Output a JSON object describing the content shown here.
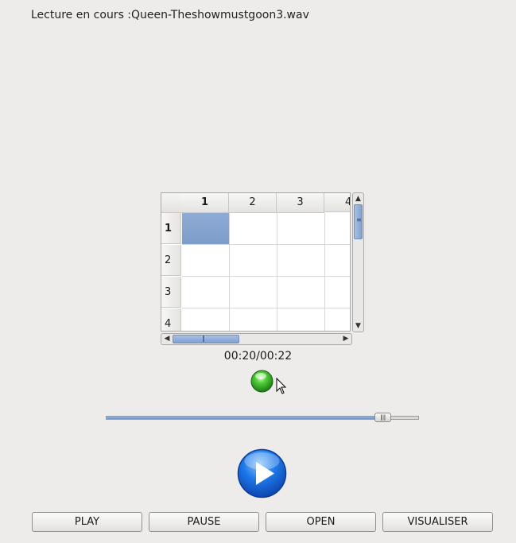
{
  "now_playing": {
    "label": "Lecture en cours :",
    "filename": "Queen-Theshowmustgoon3.wav"
  },
  "table": {
    "columns": [
      "1",
      "2",
      "3",
      "4"
    ],
    "rows": [
      "1",
      "2",
      "3",
      "4"
    ],
    "selected_cell": {
      "row": "1",
      "column": "1"
    }
  },
  "time": "00:20/00:22",
  "status_led": {
    "icon": "green-ball-icon",
    "color": "#2fae1f"
  },
  "progress": {
    "value_fraction": 0.885
  },
  "play_icon": {
    "icon": "play-circle-icon",
    "color": "#1f6fe0"
  },
  "buttons": {
    "play": "PLAY",
    "pause": "PAUSE",
    "open": "OPEN",
    "visualize": "VISUALISER"
  }
}
